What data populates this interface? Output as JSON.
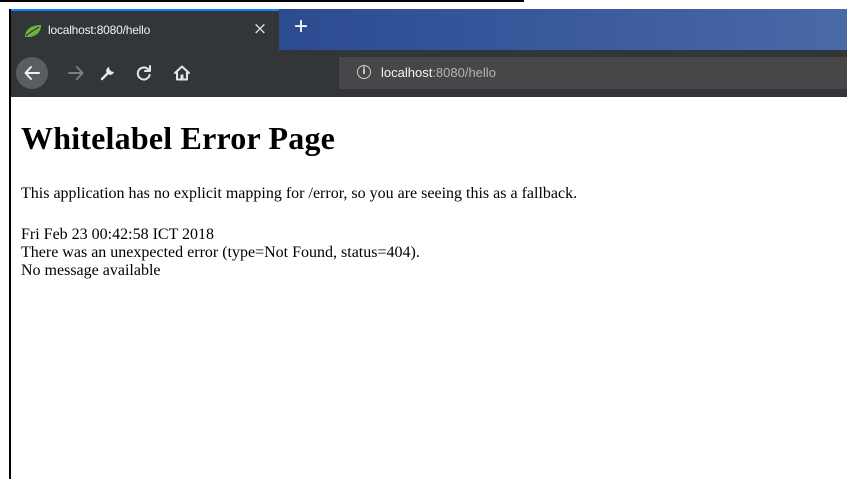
{
  "browser": {
    "tab": {
      "title": "localhost:8080/hello",
      "close_label": "×"
    },
    "new_tab_label": "+",
    "address_bar": {
      "host": "localhost",
      "path": ":8080/hello"
    },
    "icons": [
      "spring-leaf-icon",
      "close-icon",
      "plus-icon",
      "back-arrow-icon",
      "forward-arrow-icon",
      "wrench-icon",
      "reload-icon",
      "home-icon",
      "info-icon"
    ]
  },
  "page": {
    "heading": "Whitelabel Error Page",
    "description": "This application has no explicit mapping for /error, so you are seeing this as a fallback.",
    "timestamp": "Fri Feb 23 00:42:58 ICT 2018",
    "error_line": "There was an unexpected error (type=Not Found, status=404).",
    "message": "No message available"
  },
  "colors": {
    "tab_bg": "#323639",
    "tab_accent": "#0a84ff",
    "urlbar_bg": "#474749",
    "spring_green": "#6db33f"
  }
}
